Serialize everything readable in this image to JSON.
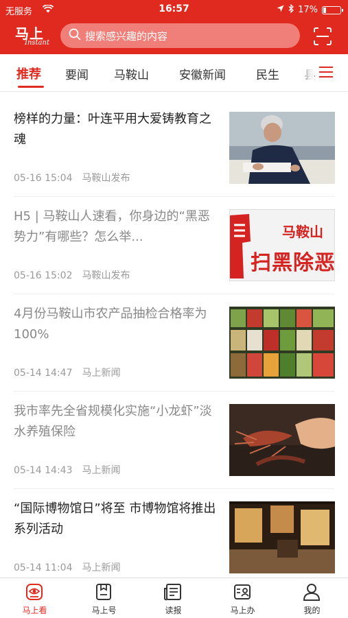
{
  "status_bar": {
    "carrier": "无服务",
    "time": "16:57",
    "battery": "17%",
    "battery_level": 0.17
  },
  "header": {
    "logo_cn": "马上",
    "logo_en": "Instant",
    "search_placeholder": "搜索感兴趣的内容",
    "scan_icon": "scan-icon"
  },
  "channels": {
    "tabs": [
      {
        "label": "推荐",
        "active": true
      },
      {
        "label": "要闻"
      },
      {
        "label": "马鞍山"
      },
      {
        "label": "安徽新闻"
      },
      {
        "label": "民生"
      },
      {
        "label": "县"
      }
    ],
    "menu_icon": "hamburger-icon"
  },
  "articles": [
    {
      "title": "榜样的力量：叶连平用大爱铸教育之魂",
      "date": "05-16 15:04",
      "source": "马鞍山发布",
      "read": false,
      "thumb_colors": {
        "bg": "#6e7f8e",
        "accent": "#1f2a44"
      }
    },
    {
      "title": "H5 | 马鞍山人速看，你身边的“黑恶势力”有哪些？怎么举...",
      "date": "05-16 15:02",
      "source": "马鞍山发布",
      "read": true,
      "thumb_text_top": "马鞍山",
      "thumb_text_bottom": "扫黑除恶",
      "thumb_colors": {
        "bg": "#f3f3f3",
        "accent": "#d42320"
      }
    },
    {
      "title": "4月份马鞍山市农产品抽检合格率为100%",
      "date": "05-14 14:47",
      "source": "马上新闻",
      "read": true,
      "thumb_colors": {
        "bg": "#3d5a2a",
        "accent": "#c23b2e"
      }
    },
    {
      "title": "我市率先全省规模化实施“小龙虾”淡水养殖保险",
      "date": "05-14 14:43",
      "source": "马上新闻",
      "read": true,
      "thumb_colors": {
        "bg": "#3b2a22",
        "accent": "#c96a4a"
      }
    },
    {
      "title": "“国际博物馆日”将至 市博物馆将推出系列活动",
      "date": "05-14 11:04",
      "source": "马上新闻",
      "read": false,
      "thumb_colors": {
        "bg": "#3a2818",
        "accent": "#d8a65a"
      }
    }
  ],
  "tabbar": [
    {
      "label": "马上看",
      "icon": "eye-news-icon",
      "active": true
    },
    {
      "label": "马上号",
      "icon": "bookmark-h-icon"
    },
    {
      "label": "读报",
      "icon": "newspaper-icon"
    },
    {
      "label": "马上办",
      "icon": "service-card-icon"
    },
    {
      "label": "我的",
      "icon": "user-icon"
    }
  ],
  "colors": {
    "brand": "#e02a20",
    "search_bg": "#ef7f78",
    "meta": "#999999"
  }
}
